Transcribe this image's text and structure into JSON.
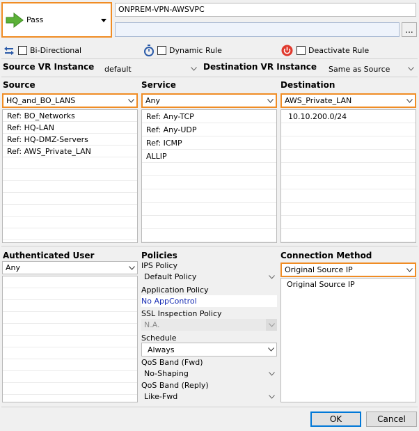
{
  "action": {
    "label": "Pass"
  },
  "rule": {
    "name": "ONPREM-VPN-AWSVPC",
    "description": "",
    "browse_label": "..."
  },
  "options": {
    "bidirectional": "Bi-Directional",
    "dynamic_rule": "Dynamic Rule",
    "deactivate_rule": "Deactivate Rule"
  },
  "vr": {
    "source_label": "Source VR Instance",
    "source_value": "default",
    "dest_label": "Destination VR Instance",
    "dest_value": "Same as Source"
  },
  "source": {
    "header": "Source",
    "selected": "HQ_and_BO_LANS",
    "items": [
      "Ref: BO_Networks",
      "Ref: HQ-LAN",
      "Ref: HQ-DMZ-Servers",
      "Ref: AWS_Private_LAN"
    ]
  },
  "service": {
    "header": "Service",
    "selected": "Any",
    "items": [
      "Ref: Any-TCP",
      "Ref: Any-UDP",
      "Ref: ICMP",
      "ALLIP"
    ]
  },
  "destination": {
    "header": "Destination",
    "selected": "AWS_Private_LAN",
    "items": [
      "10.10.200.0/24"
    ]
  },
  "auth_user": {
    "header": "Authenticated User",
    "selected": "Any"
  },
  "policies": {
    "header": "Policies",
    "ips_label": "IPS Policy",
    "ips_value": "Default Policy",
    "app_label": "Application Policy",
    "app_value": "No AppControl",
    "ssl_label": "SSL Inspection Policy",
    "ssl_value": "N.A.",
    "schedule_label": "Schedule",
    "schedule_value": "Always",
    "qos_fwd_label": "QoS Band (Fwd)",
    "qos_fwd_value": "No-Shaping",
    "qos_reply_label": "QoS Band (Reply)",
    "qos_reply_value": "Like-Fwd"
  },
  "connection": {
    "header": "Connection Method",
    "selected": "Original Source IP",
    "items": [
      "Original Source IP"
    ]
  },
  "buttons": {
    "ok": "OK",
    "cancel": "Cancel"
  },
  "colors": {
    "highlight": "#f08c24",
    "action_arrow": "#5bb137",
    "link": "#1a2fb5",
    "deactivate_icon": "#e03a2e"
  }
}
